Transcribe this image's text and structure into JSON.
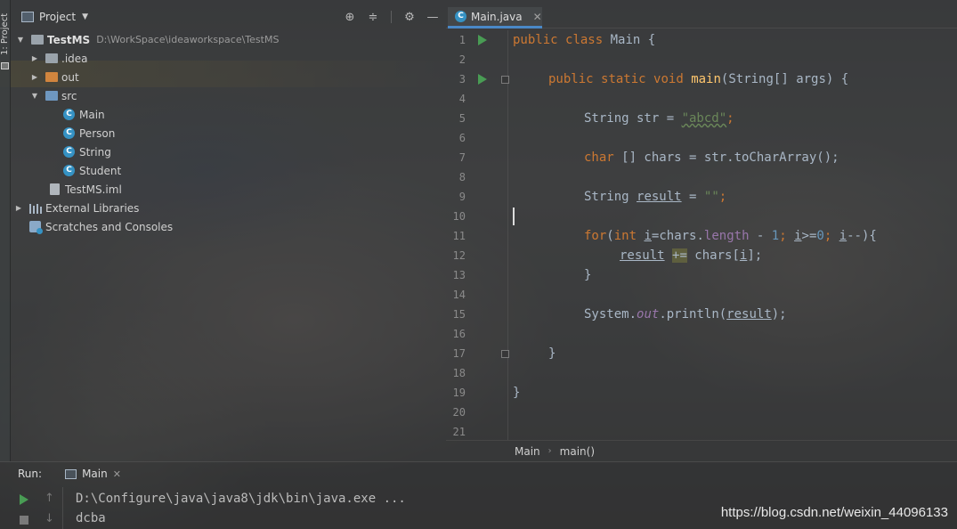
{
  "tool_strip": {
    "project_tab": "1: Project"
  },
  "project_panel": {
    "title": "Project",
    "tree": [
      {
        "label": "TestMS",
        "path": "D:\\WorkSpace\\ideaworkspace\\TestMS",
        "icon": "module-folder-icon",
        "expanded": true
      },
      {
        "label": ".idea",
        "icon": "folder-icon",
        "expanded": false
      },
      {
        "label": "out",
        "icon": "excluded-folder-icon",
        "expanded": false
      },
      {
        "label": "src",
        "icon": "source-folder-icon",
        "expanded": true
      },
      {
        "label": "Main",
        "icon": "java-class-icon"
      },
      {
        "label": "Person",
        "icon": "java-class-icon"
      },
      {
        "label": "String",
        "icon": "java-class-icon"
      },
      {
        "label": "Student",
        "icon": "java-class-icon"
      },
      {
        "label": "TestMS.iml",
        "icon": "iml-file-icon"
      },
      {
        "label": "External Libraries",
        "icon": "libraries-icon",
        "expanded": false
      },
      {
        "label": "Scratches and Consoles",
        "icon": "scratches-icon"
      }
    ]
  },
  "editor": {
    "tab_label": "Main.java",
    "line_numbers": [
      "1",
      "2",
      "3",
      "4",
      "5",
      "6",
      "7",
      "8",
      "9",
      "10",
      "11",
      "12",
      "13",
      "14",
      "15",
      "16",
      "17",
      "18",
      "19",
      "20",
      "21"
    ],
    "code": {
      "l1": {
        "kw1": "public",
        "kw2": "class",
        "rest": " Main {"
      },
      "l3": {
        "kw1": "public",
        "kw2": "static",
        "kw3": "void",
        "fn": "main",
        "rest": "(String[] args) {"
      },
      "l5": {
        "pre": "String str = ",
        "str": "\"abcd\"",
        "post": ";"
      },
      "l7": {
        "kw": "char",
        "rest": " [] chars = str.toCharArray();"
      },
      "l9": {
        "pre": "String ",
        "var": "result",
        "mid": " = ",
        "str": "\"\"",
        "post": ";"
      },
      "l11": {
        "kw1": "for",
        "p1": "(",
        "kw2": "int",
        "sp": " ",
        "v1": "i",
        "p2": "=chars.",
        "field": "length",
        "p3": " - ",
        "n1": "1",
        "p4": "; ",
        "v2": "i",
        "p5": ">=",
        "n2": "0",
        "p6": "; ",
        "v3": "i",
        "p7": "--){"
      },
      "l12": {
        "var": "result",
        "sp": " ",
        "op": "+=",
        "mid": " chars[",
        "idx": "i",
        "post": "];"
      },
      "l13": "}",
      "l15": {
        "pre": "System.",
        "out": "out",
        "mid": ".println(",
        "var": "result",
        "post": ");"
      },
      "l17": "}",
      "l19": "}"
    },
    "breadcrumb": [
      "Main",
      "main()"
    ]
  },
  "run_panel": {
    "title": "Run:",
    "tab_label": "Main",
    "console_lines": [
      "D:\\Configure\\java\\java8\\jdk\\bin\\java.exe ...",
      "dcba"
    ]
  },
  "watermark": "https://blog.csdn.net/weixin_44096133",
  "colors": {
    "keyword": "#cc7832",
    "method": "#ffc66d",
    "string": "#6a8759",
    "number": "#6897bb",
    "field": "#9876aa",
    "run_green": "#499c54",
    "class_icon": "#3592c4"
  }
}
